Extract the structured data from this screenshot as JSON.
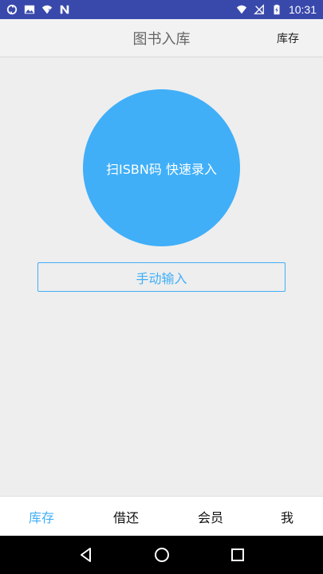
{
  "status_bar": {
    "time": "10:31",
    "left_icons": [
      "sync-icon",
      "image-icon",
      "wifi-unknown-icon",
      "n-notification-icon"
    ],
    "right_icons": [
      "wifi-icon",
      "no-signal-icon",
      "battery-charging-icon"
    ]
  },
  "header": {
    "title": "图书入库",
    "action_label": "库存"
  },
  "main": {
    "scan_label": "扫ISBN码 快速录入",
    "manual_label": "手动输入"
  },
  "tabs": [
    {
      "label": "库存",
      "active": true
    },
    {
      "label": "借还",
      "active": false
    },
    {
      "label": "会员",
      "active": false
    },
    {
      "label": "我",
      "active": false
    }
  ],
  "colors": {
    "accent": "#40aff8",
    "status_bar": "#3949ab",
    "background": "#eeeeee"
  },
  "nav_icons": [
    "back-icon",
    "home-icon",
    "recents-icon"
  ]
}
